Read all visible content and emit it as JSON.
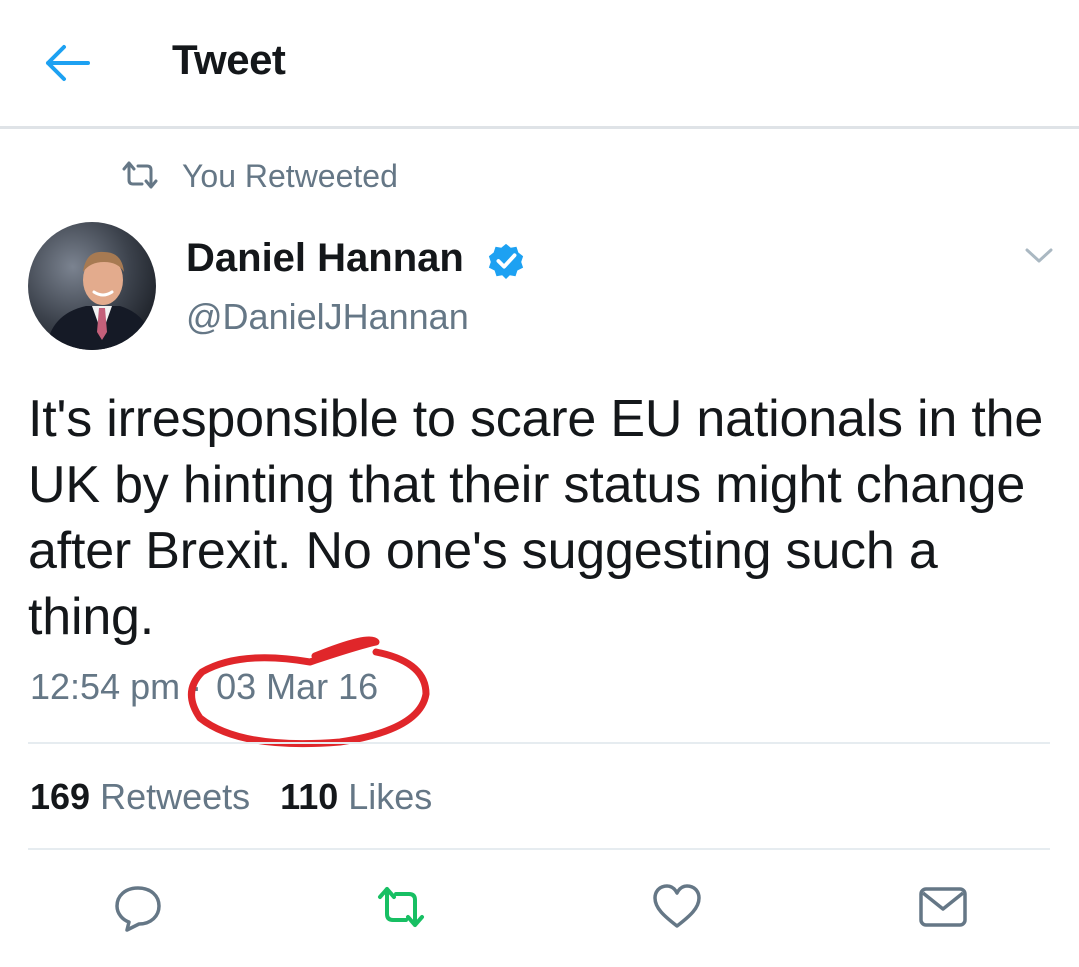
{
  "header": {
    "back_icon": "arrow-left-icon",
    "title": "Tweet"
  },
  "retweet_context": {
    "icon": "retweet-icon",
    "text": "You Retweeted"
  },
  "author": {
    "name": "Daniel Hannan",
    "verified": true,
    "handle": "@DanielJHannan"
  },
  "tweet": {
    "text": "It's irresponsible to scare EU nationals in the UK by hinting that their status might change after Brexit. No one's suggesting such a thing.",
    "time": "12:54 pm ·",
    "date": "03 Mar 16"
  },
  "stats": {
    "retweets_count": "169",
    "retweets_label": "Retweets",
    "likes_count": "110",
    "likes_label": "Likes"
  },
  "actions": [
    "reply-icon",
    "retweet-icon",
    "like-icon",
    "share-icon"
  ],
  "colors": {
    "accent": "#1da1f2",
    "retweeted": "#17bf63",
    "secondary_text": "#657786",
    "annotation": "#e0262a"
  }
}
